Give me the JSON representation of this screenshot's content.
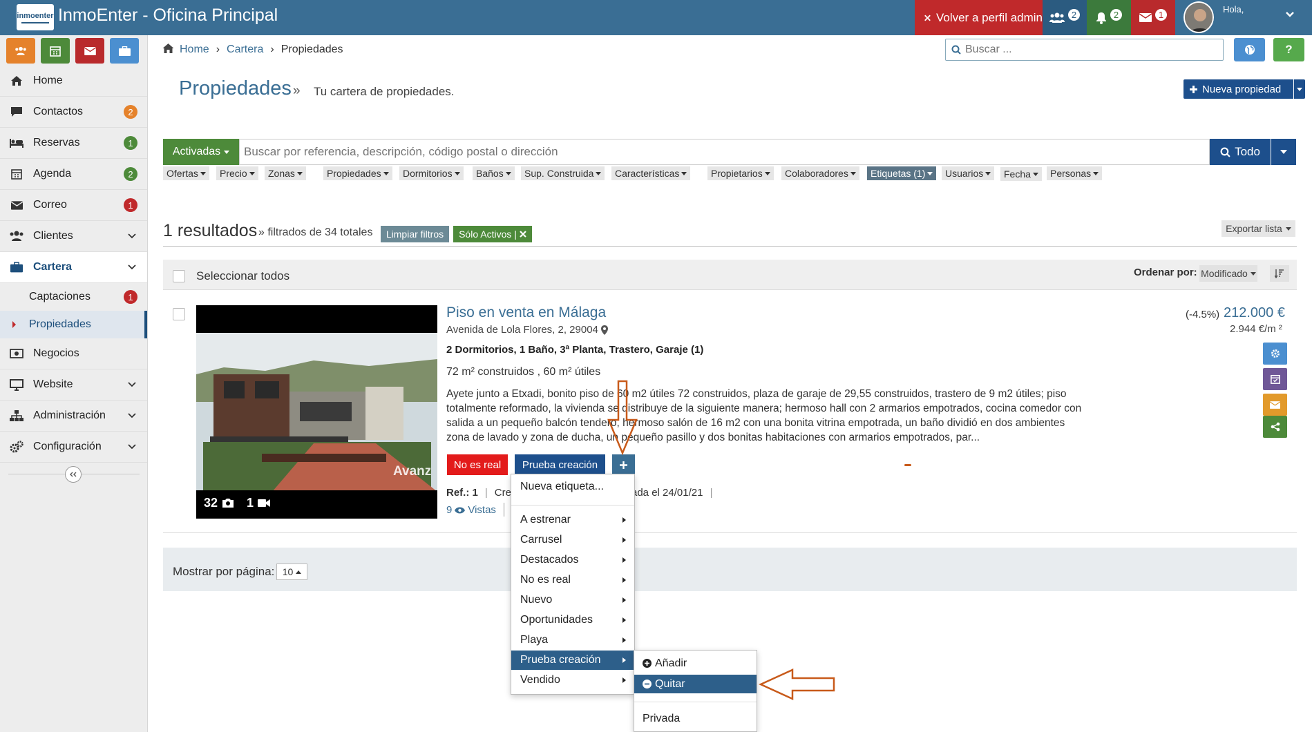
{
  "app": {
    "title": "InmoEnter - Oficina Principal",
    "logo_text": "inmoenter"
  },
  "topbar": {
    "admin_label": "Volver a perfil admin",
    "users_badge": "2",
    "bell_badge": "2",
    "mail_badge": "1",
    "greeting": "Hola,"
  },
  "quick_buttons": [
    {
      "icon": "users-icon",
      "color": "#e5822b"
    },
    {
      "icon": "calendar-icon",
      "color": "#4d8a3a"
    },
    {
      "icon": "envelope-icon",
      "color": "#b92a2c"
    },
    {
      "icon": "briefcase-icon",
      "color": "#4b8fd0"
    }
  ],
  "sidebar": {
    "items": [
      {
        "label": "Home",
        "icon": "home-icon"
      },
      {
        "label": "Contactos",
        "icon": "comment-icon",
        "badge": "2",
        "badge_color": "#e5822b"
      },
      {
        "label": "Reservas",
        "icon": "bed-icon",
        "badge": "1",
        "badge_color": "#4d8a3a"
      },
      {
        "label": "Agenda",
        "icon": "calendar-icon",
        "badge": "2",
        "badge_color": "#4d8a3a"
      },
      {
        "label": "Correo",
        "icon": "envelope-icon",
        "badge": "1",
        "badge_color": "#c0292b"
      },
      {
        "label": "Clientes",
        "icon": "users-icon"
      },
      {
        "label": "Cartera",
        "icon": "briefcase-icon"
      },
      {
        "label": "Negocios",
        "icon": "money-icon"
      },
      {
        "label": "Website",
        "icon": "desktop-icon"
      },
      {
        "label": "Administración",
        "icon": "sitemap-icon"
      },
      {
        "label": "Configuración",
        "icon": "cogs-icon"
      }
    ],
    "sub_items": [
      {
        "label": "Captaciones",
        "badge": "1",
        "badge_color": "#c0292b"
      },
      {
        "label": "Propiedades"
      }
    ]
  },
  "breadcrumb": [
    "Home",
    "Cartera",
    "Propiedades"
  ],
  "search": {
    "placeholder": "Buscar ..."
  },
  "page": {
    "title": "Propiedades",
    "raquo": "»",
    "subtitle": "Tu cartera de propiedades.",
    "new_button": "Nueva propiedad"
  },
  "filter": {
    "status": "Activadas",
    "placeholder": "Buscar por referencia, descripción, código postal o dirección",
    "scope": "Todo",
    "chips": [
      "Ofertas",
      "Precio",
      "Zonas",
      "Propiedades",
      "Dormitorios",
      "Baños",
      "Sup. Construida",
      "Características",
      "Propietarios",
      "Colaboradores",
      "Etiquetas (1)",
      "Usuarios",
      "Fecha",
      "Personas"
    ]
  },
  "results": {
    "count": "1 resultados",
    "of_total": "» filtrados de 34 totales",
    "clear": "Limpiar filtros",
    "active_only": "Sólo Activos |",
    "export": "Exportar lista",
    "select_all": "Seleccionar todos",
    "order_label": "Ordenar por:",
    "order_value": "Modificado"
  },
  "property": {
    "title": "Piso en venta en Málaga",
    "address": "Avenida de Lola Flores, 2, 29004",
    "features": "2 Dormitorios, 1 Baño, 3ª Planta, Trastero, Garaje (1)",
    "area": "72 m² construidos , 60 m² útiles",
    "description": "Ayete junto a Etxadi, bonito piso de 60 m2 útiles 72 construidos, plaza de garaje de 29,55 construidos, trastero de 9 m2 útiles; piso totalmente reformado, la vivienda se distribuye de la siguiente manera; hermoso hall con 2 armarios empotrados, cocina comedor con salida a un pequeño balcón tendero, hermoso salón de 16 m2 con una bonita vitrina empotrada, un baño dividió en dos ambientes zona de lavado y zona de ducha, un pequeño pasillo y dos bonitas habitaciones con armarios empotrados, par...",
    "tags": [
      "No es real",
      "Prueba creación"
    ],
    "ref_label": "Ref.: 1",
    "created_fragment": "Crea",
    "modified_fragment": "ada el 24/01/21",
    "views": "9",
    "views_label": "Vistas",
    "photo_count": "32",
    "video_count": "1",
    "watermark": "Avanz",
    "price_change": "(-4.5%)",
    "price": "212.000 €",
    "price_m2": "2.944 €/m ²"
  },
  "pager": {
    "label": "Mostrar por página:",
    "value": "10"
  },
  "tag_menu": {
    "new_label": "Nueva etiqueta...",
    "items": [
      "A estrenar",
      "Carrusel",
      "Destacados",
      "No es real",
      "Nuevo",
      "Oportunidades",
      "Playa",
      "Prueba creación",
      "Vendido"
    ]
  },
  "sub_menu": {
    "add": "Añadir",
    "remove": "Quitar",
    "private": "Privada"
  },
  "colors": {
    "primary": "#3a6e94",
    "dark_blue": "#1d4f8c",
    "green": "#4d8a3a",
    "red": "#c0292b",
    "annotation": "#c85a1a"
  }
}
